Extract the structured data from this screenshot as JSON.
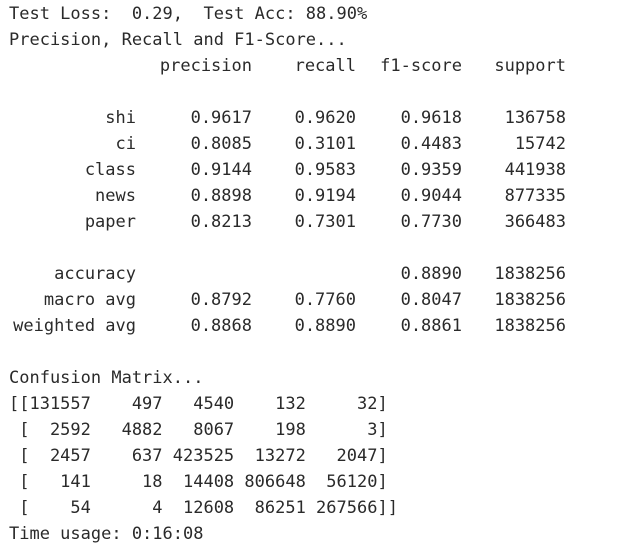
{
  "header": {
    "test_line": "Test Loss:  0.29,  Test Acc: 88.90%",
    "report_title": "Precision, Recall and F1-Score..."
  },
  "report": {
    "columns": [
      "precision",
      "recall",
      "f1-score",
      "support"
    ],
    "rows": [
      {
        "label": "shi",
        "precision": "0.9617",
        "recall": "0.9620",
        "f1": "0.9618",
        "support": "136758"
      },
      {
        "label": "ci",
        "precision": "0.8085",
        "recall": "0.3101",
        "f1": "0.4483",
        "support": "15742"
      },
      {
        "label": "class",
        "precision": "0.9144",
        "recall": "0.9583",
        "f1": "0.9359",
        "support": "441938"
      },
      {
        "label": "news",
        "precision": "0.8898",
        "recall": "0.9194",
        "f1": "0.9044",
        "support": "877335"
      },
      {
        "label": "paper",
        "precision": "0.8213",
        "recall": "0.7301",
        "f1": "0.7730",
        "support": "366483"
      }
    ],
    "summary": [
      {
        "label": "accuracy",
        "precision": "",
        "recall": "",
        "f1": "0.8890",
        "support": "1838256"
      },
      {
        "label": "macro avg",
        "precision": "0.8792",
        "recall": "0.7760",
        "f1": "0.8047",
        "support": "1838256"
      },
      {
        "label": "weighted avg",
        "precision": "0.8868",
        "recall": "0.8890",
        "f1": "0.8861",
        "support": "1838256"
      }
    ]
  },
  "confusion": {
    "title": "Confusion Matrix...",
    "lines": [
      "[[131557    497   4540    132     32]",
      " [  2592   4882   8067    198      3]",
      " [  2457    637 423525  13272   2047]",
      " [   141     18  14408 806648  56120]",
      " [    54      4  12608  86251 267566]]"
    ]
  },
  "footer": {
    "time_usage": "Time usage: 0:16:08"
  }
}
